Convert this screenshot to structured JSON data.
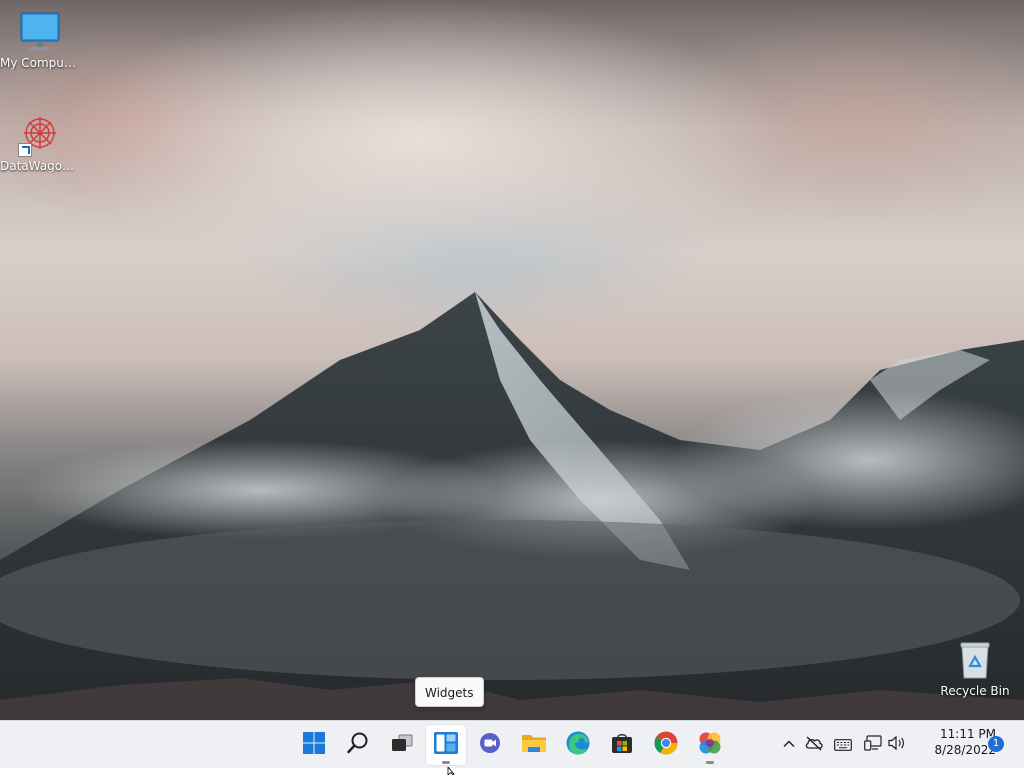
{
  "desktop": {
    "icons": [
      {
        "label": "My Computer",
        "icon": "monitor-icon"
      },
      {
        "label": "DataWagon...",
        "icon": "datawagon-app-icon"
      },
      {
        "label": "Recycle Bin",
        "icon": "recycle-bin-icon"
      }
    ]
  },
  "tooltip": {
    "text": "Widgets"
  },
  "taskbar": {
    "apps": [
      {
        "name": "Start",
        "icon": "windows-start-icon"
      },
      {
        "name": "Search",
        "icon": "search-icon"
      },
      {
        "name": "Task View",
        "icon": "task-view-icon"
      },
      {
        "name": "Widgets",
        "icon": "widgets-icon"
      },
      {
        "name": "Chat",
        "icon": "chat-icon"
      },
      {
        "name": "File Explorer",
        "icon": "folder-icon"
      },
      {
        "name": "Microsoft Edge",
        "icon": "edge-icon"
      },
      {
        "name": "Microsoft Store",
        "icon": "store-icon"
      },
      {
        "name": "Google Chrome",
        "icon": "chrome-icon"
      },
      {
        "name": "App",
        "icon": "colorful-app-icon"
      }
    ],
    "tray": {
      "icons": [
        "chevron-up-icon",
        "cloud-offline-icon",
        "keyboard-icon",
        "network-icon",
        "volume-icon"
      ],
      "time": "11:11 PM",
      "date": "8/28/2022",
      "notification_count": "1"
    }
  },
  "colors": {
    "taskbar_bg": "#eef0f3",
    "accent": "#1f6fd1"
  }
}
